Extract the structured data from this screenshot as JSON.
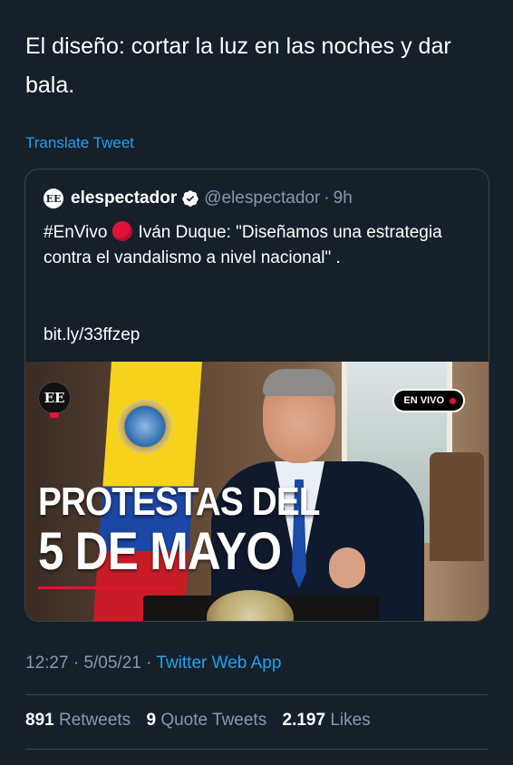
{
  "tweet": {
    "text": "El diseño: cortar la luz en las noches y dar bala.",
    "translate_label": "Translate Tweet"
  },
  "quoted_tweet": {
    "display_name": "elespectador",
    "handle": "@elespectador",
    "separator": "·",
    "time_ago": "9h",
    "logo_text": "EE",
    "text_hashtag": "#EnVivo",
    "text_main": "Iván Duque: \"Diseñamos una estrategia contra el vandalismo a nivel nacional\" .",
    "link": "bit.ly/33ffzep",
    "media": {
      "logo_text": "EE",
      "live_badge": "EN VIVO",
      "headline_line1": "PROTESTAS DEL",
      "headline_line2": "5 DE MAYO"
    }
  },
  "meta": {
    "time": "12:27",
    "date": "5/05/21",
    "separator": "·",
    "app": "Twitter Web App"
  },
  "stats": {
    "retweets_count": "891",
    "retweets_label": "Retweets",
    "quotes_count": "9",
    "quotes_label": "Quote Tweets",
    "likes_count": "2.197",
    "likes_label": "Likes"
  },
  "colors": {
    "background": "#15202b",
    "link": "#1da1f2",
    "muted": "#8899a6",
    "border": "#38444d",
    "live_red": "#e0123a"
  }
}
